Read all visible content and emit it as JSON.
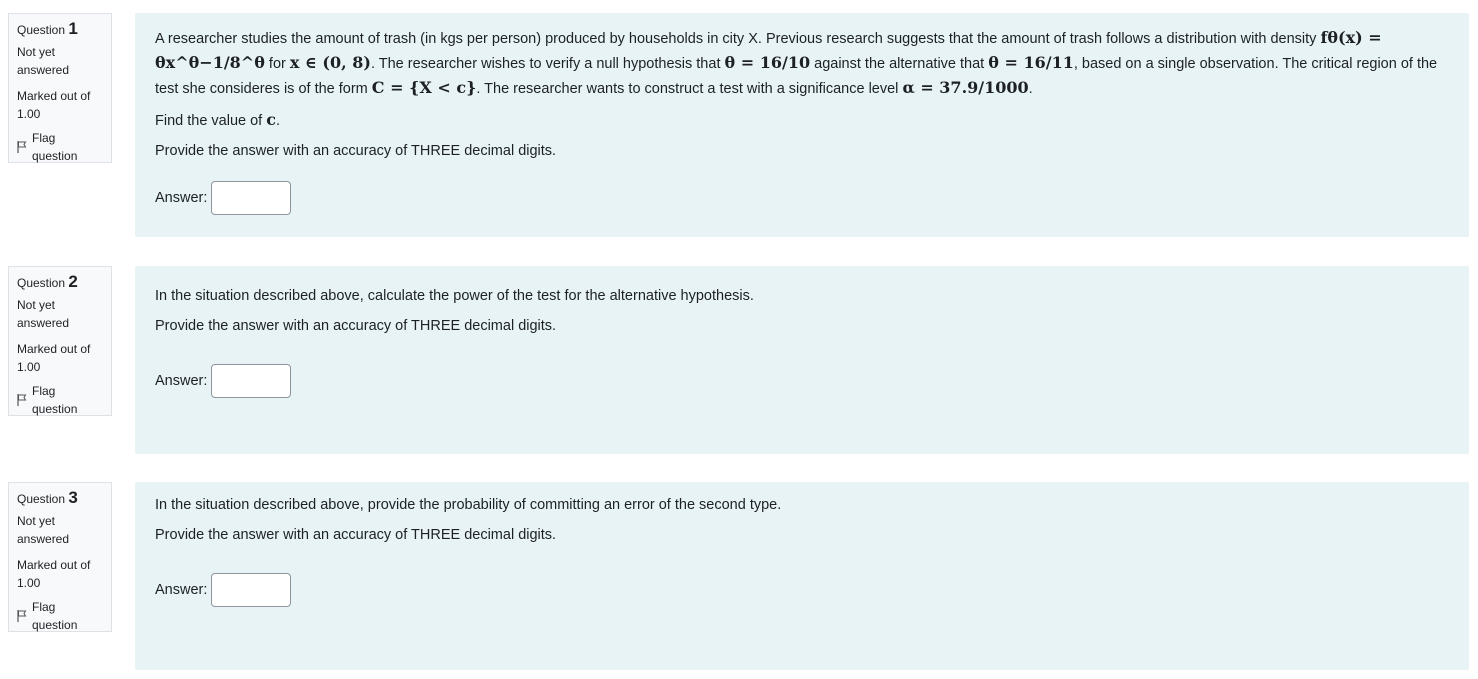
{
  "questions": [
    {
      "label": "Question",
      "number": "1",
      "state": "Not yet answered",
      "grade": "Marked out of 1.00",
      "flag_label": "Flag question",
      "text_parts": {
        "p1a": "A researcher studies the amount of trash (in kgs per person) produced by households in city X. Previous research suggests that the amount of trash follows a distribution with density",
        "formula_density": "fθ(x) = θx^θ−1/8^θ",
        "p1b": "for",
        "formula_domain": "x ∈ (0, 8)",
        "p1c": ". The researcher wishes to verify a null hypothesis that",
        "formula_h0": "θ = 16/10",
        "p1d": "against the alternative that",
        "formula_h1": "θ = 16/11",
        "p1e": ", based on a single observation. The critical region of the test she consideres is of the form",
        "formula_region": "C = {X < c}",
        "p1f": ". The researcher wants to construct a test with a significance level",
        "formula_alpha": "α = 37.9/1000",
        "p1g": ".",
        "p2a": "Find the value of",
        "formula_c": "c",
        "p2b": ".",
        "p3": "Provide the answer with an accuracy of THREE decimal digits."
      },
      "answer_label": "Answer:",
      "answer_value": ""
    },
    {
      "label": "Question",
      "number": "2",
      "state": "Not yet answered",
      "grade": "Marked out of 1.00",
      "flag_label": "Flag question",
      "p1": "In the situation described above, calculate the power of the test for the alternative hypothesis.",
      "p2": "Provide the answer with an accuracy of THREE decimal digits.",
      "answer_label": "Answer:",
      "answer_value": ""
    },
    {
      "label": "Question",
      "number": "3",
      "state": "Not yet answered",
      "grade": "Marked out of 1.00",
      "flag_label": "Flag question",
      "p1": "In the situation described above, provide the probability of committing an error of the second type.",
      "p2": "Provide the answer with an accuracy of THREE decimal digits.",
      "answer_label": "Answer:",
      "answer_value": ""
    }
  ],
  "colors": {
    "info_bg": "#f8f9fa",
    "content_bg": "#e7f3f5",
    "text": "#1d2125"
  }
}
